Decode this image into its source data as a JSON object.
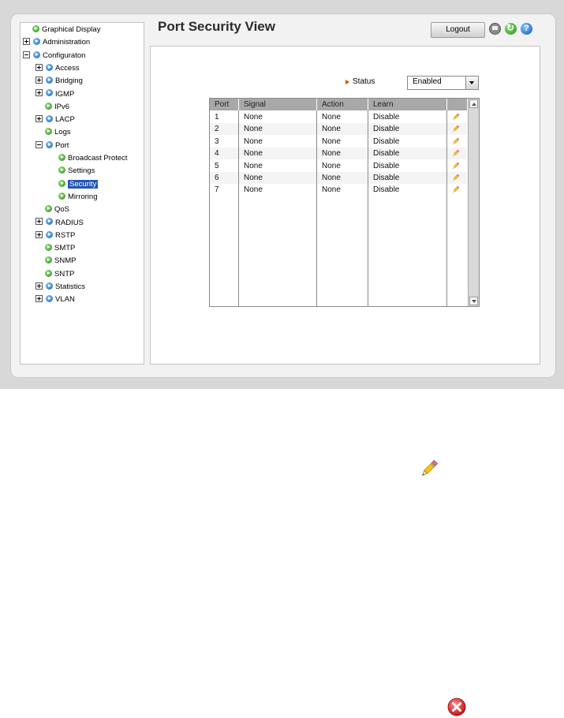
{
  "header": {
    "title": "Port Security View",
    "logout_label": "Logout"
  },
  "sidebar": {
    "items": [
      {
        "label": "Graphical Display",
        "icon": "green-arrow-icon",
        "expander": "none",
        "selected": false
      },
      {
        "label": "Administration",
        "icon": "blue-arrow-icon",
        "expander": "plus",
        "selected": false
      },
      {
        "label": "Configuraton",
        "icon": "blue-arrow-icon",
        "expander": "minus",
        "selected": false
      },
      {
        "label": "Access",
        "icon": "blue-arrow-icon",
        "expander": "plus",
        "selected": false
      },
      {
        "label": "Bridging",
        "icon": "blue-arrow-icon",
        "expander": "plus",
        "selected": false
      },
      {
        "label": "IGMP",
        "icon": "blue-arrow-icon",
        "expander": "plus",
        "selected": false
      },
      {
        "label": "IPv6",
        "icon": "green-arrow-icon",
        "expander": "none",
        "selected": false
      },
      {
        "label": "LACP",
        "icon": "blue-arrow-icon",
        "expander": "plus",
        "selected": false
      },
      {
        "label": "Logs",
        "icon": "green-arrow-icon",
        "expander": "none",
        "selected": false
      },
      {
        "label": "Port",
        "icon": "blue-arrow-icon",
        "expander": "minus",
        "selected": false
      },
      {
        "label": "Broadcast Protect",
        "icon": "green-arrow-icon",
        "expander": "none",
        "selected": false
      },
      {
        "label": "Settings",
        "icon": "green-arrow-icon",
        "expander": "none",
        "selected": false
      },
      {
        "label": "Security",
        "icon": "green-arrow-icon",
        "expander": "none",
        "selected": true
      },
      {
        "label": "Mirroring",
        "icon": "green-arrow-icon",
        "expander": "none",
        "selected": false
      },
      {
        "label": "QoS",
        "icon": "green-arrow-icon",
        "expander": "none",
        "selected": false
      },
      {
        "label": "RADIUS",
        "icon": "blue-arrow-icon",
        "expander": "plus",
        "selected": false
      },
      {
        "label": "RSTP",
        "icon": "blue-arrow-icon",
        "expander": "plus",
        "selected": false
      },
      {
        "label": "SMTP",
        "icon": "green-arrow-icon",
        "expander": "none",
        "selected": false
      },
      {
        "label": "SNMP",
        "icon": "green-arrow-icon",
        "expander": "none",
        "selected": false
      },
      {
        "label": "SNTP",
        "icon": "green-arrow-icon",
        "expander": "none",
        "selected": false
      },
      {
        "label": "Statistics",
        "icon": "blue-arrow-icon",
        "expander": "plus",
        "selected": false
      },
      {
        "label": "VLAN",
        "icon": "blue-arrow-icon",
        "expander": "plus",
        "selected": false
      }
    ]
  },
  "status": {
    "label": "Status",
    "value": "Enabled"
  },
  "table": {
    "columns": [
      "Port",
      "Signal",
      "Action",
      "Learn"
    ],
    "rows": [
      {
        "port": "1",
        "signal": "None",
        "action": "None",
        "learn": "Disable"
      },
      {
        "port": "2",
        "signal": "None",
        "action": "None",
        "learn": "Disable"
      },
      {
        "port": "3",
        "signal": "None",
        "action": "None",
        "learn": "Disable"
      },
      {
        "port": "4",
        "signal": "None",
        "action": "None",
        "learn": "Disable"
      },
      {
        "port": "5",
        "signal": "None",
        "action": "None",
        "learn": "Disable"
      },
      {
        "port": "6",
        "signal": "None",
        "action": "None",
        "learn": "Disable"
      },
      {
        "port": "7",
        "signal": "None",
        "action": "None",
        "learn": "Disable"
      }
    ]
  },
  "icons": [
    "save-icon",
    "refresh-icon",
    "help-icon",
    "pencil-icon",
    "close-icon"
  ],
  "colors": {
    "selected": "#2355b5",
    "header_bg": "#a8a8a8",
    "status_arrow": "#d35400"
  }
}
